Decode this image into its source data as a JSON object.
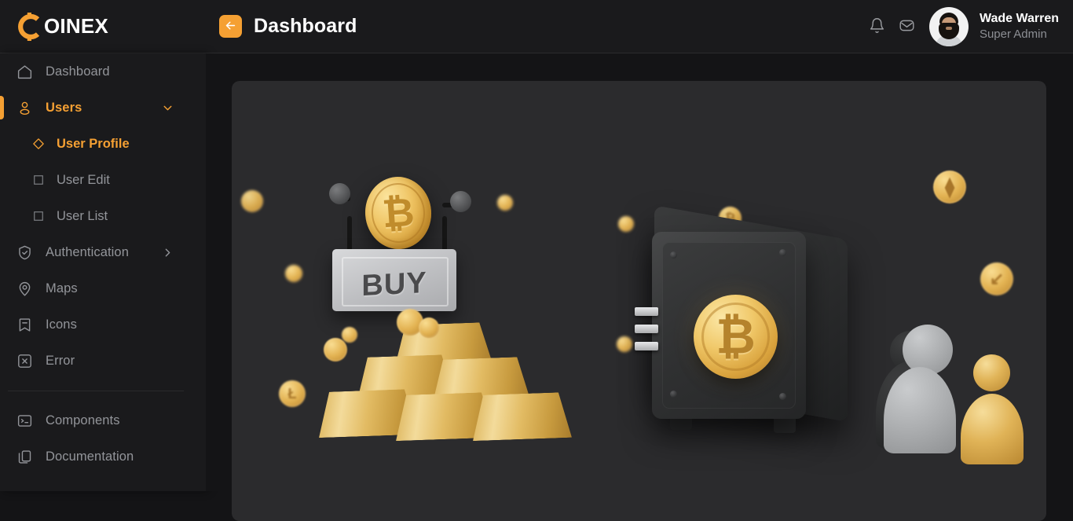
{
  "brand": {
    "name": "OINEX",
    "mark_letter": "C",
    "accent": "#f5a033"
  },
  "header": {
    "back_button_icon": "arrow-left-icon",
    "page_title": "Dashboard",
    "notifications_icon": "bell-icon",
    "messages_icon": "envelope-icon",
    "user": {
      "name": "Wade Warren",
      "role": "Super Admin"
    }
  },
  "sidebar": {
    "items": [
      {
        "label": "Dashboard",
        "icon": "home-icon",
        "active": false,
        "expandable": false
      },
      {
        "label": "Users",
        "icon": "user-icon",
        "active": true,
        "expandable": true,
        "chevron": "chevron-down-icon"
      },
      {
        "label": "Authentication",
        "icon": "shield-check-icon",
        "active": false,
        "expandable": true,
        "chevron": "chevron-right-icon"
      },
      {
        "label": "Maps",
        "icon": "map-pin-icon",
        "active": false,
        "expandable": false
      },
      {
        "label": "Icons",
        "icon": "bookmark-minus-icon",
        "active": false,
        "expandable": false
      },
      {
        "label": "Error",
        "icon": "square-x-icon",
        "active": false,
        "expandable": false
      }
    ],
    "sub_items": [
      {
        "label": "User Profile",
        "icon": "diamond-icon",
        "active": true
      },
      {
        "label": "User Edit",
        "icon": "square-icon",
        "active": false
      },
      {
        "label": "User List",
        "icon": "square-icon",
        "active": false
      }
    ],
    "footer_items": [
      {
        "label": "Components",
        "icon": "terminal-icon"
      },
      {
        "label": "Documentation",
        "icon": "copy-files-icon"
      }
    ]
  },
  "main": {
    "card": {
      "illustration_name": "crypto-3d-illustration",
      "sign_text": "BUY",
      "coin_symbols": {
        "bitcoin": "Ƀ",
        "ethereum": "⧫"
      }
    }
  },
  "colors": {
    "accent": "#f5a033",
    "page_bg": "#141416",
    "panel_bg": "#1a1a1c",
    "card_bg": "#2b2b2d",
    "text_muted": "#93959a",
    "text_strong": "#ffffff"
  }
}
